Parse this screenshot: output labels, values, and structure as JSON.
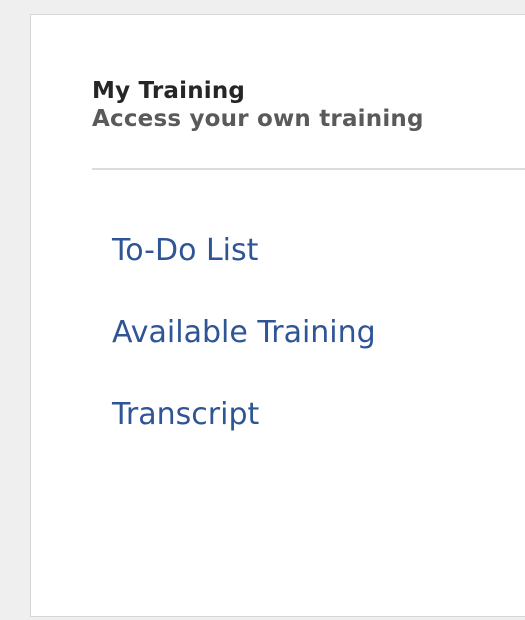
{
  "panel": {
    "title": "My Training",
    "subtitle": "Access your own training",
    "nav_items": [
      {
        "label": "To-Do List"
      },
      {
        "label": "Available Training"
      },
      {
        "label": "Transcript"
      }
    ]
  },
  "colors": {
    "link": "#2f5597",
    "title": "#262626",
    "subtitle": "#5a5a5a",
    "background": "#efefef",
    "panel": "#ffffff"
  }
}
